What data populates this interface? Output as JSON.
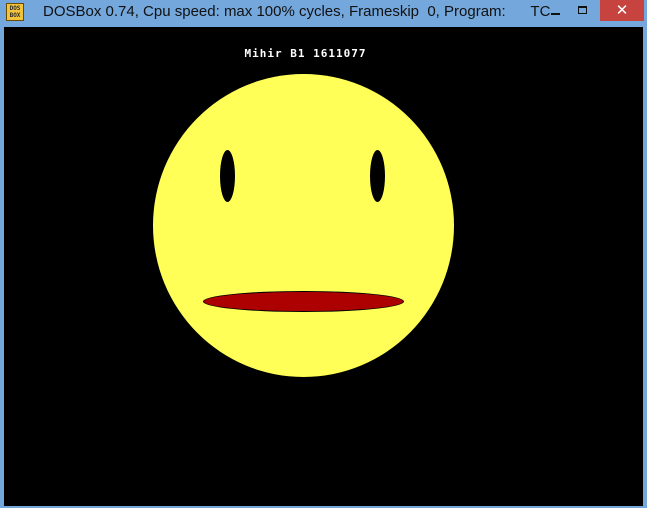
{
  "window": {
    "title": "DOSBox 0.74, Cpu speed: max 100% cycles, Frameskip  0, Program:      TC",
    "icon_label_top": "DOS",
    "icon_label_bottom": "BOX",
    "close_symbol": "✕",
    "accent_color": "#74a8dd",
    "close_color": "#c7433f"
  },
  "screen": {
    "text": "Mihir B1 1611077",
    "face": {
      "face_color": "#ffff57",
      "eye_color": "#000000",
      "mouth_color": "#ad0000"
    }
  }
}
